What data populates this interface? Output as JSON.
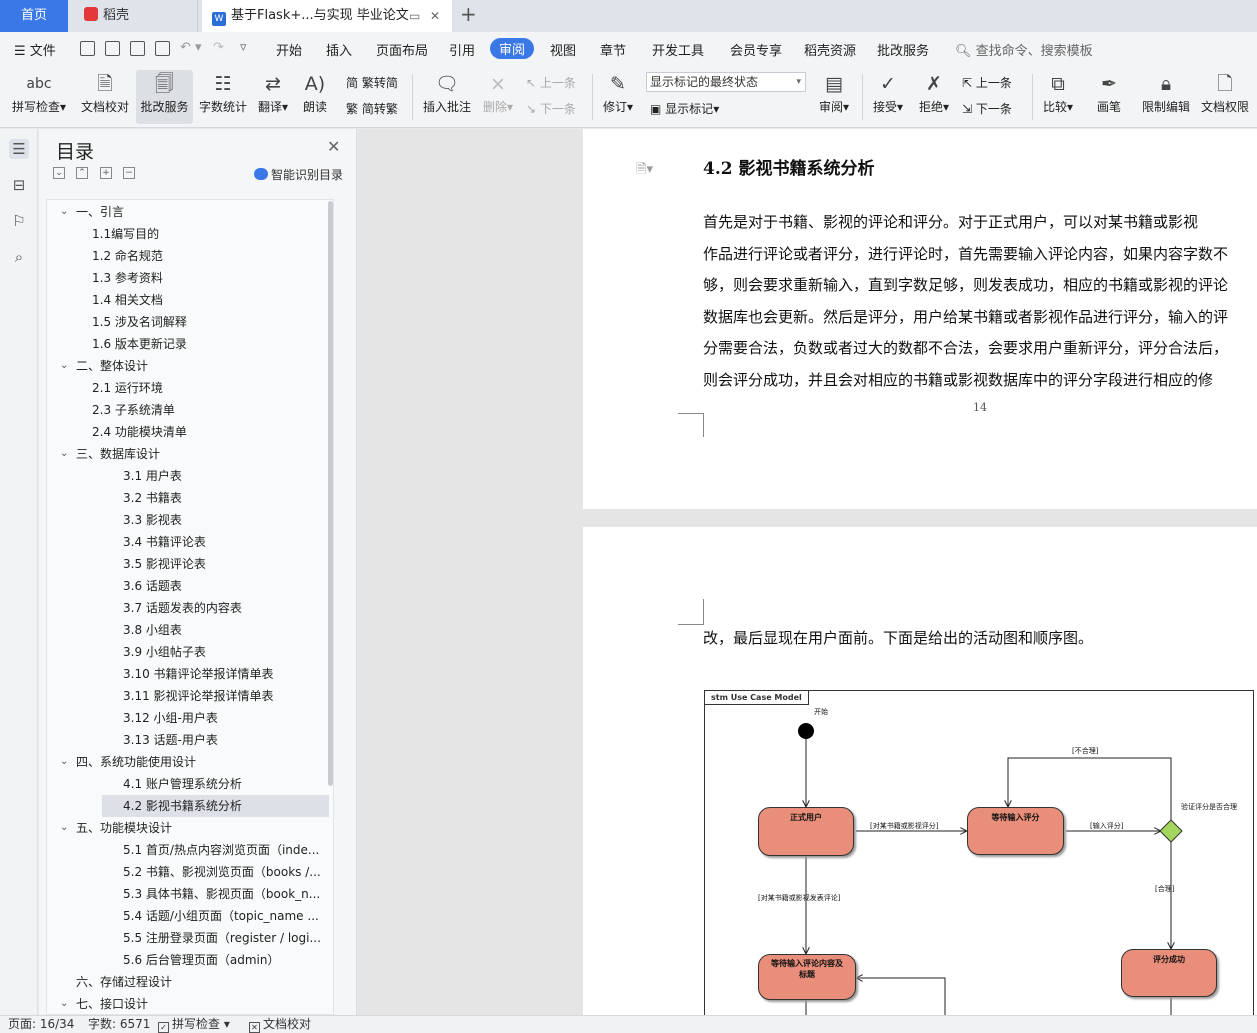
{
  "tabs": {
    "home": "首页",
    "wps": "稻壳",
    "doc": "基于Flask+...与实现 毕业论文"
  },
  "menu": [
    "文件",
    "开始",
    "插入",
    "页面布局",
    "引用",
    "审阅",
    "视图",
    "章节",
    "开发工具",
    "会员专享",
    "稻壳资源",
    "批改服务"
  ],
  "menu_active": "审阅",
  "search_cmd": "查找命令、搜索模板",
  "ribbon": {
    "spellcheck": "拼写检查",
    "doc_proof": "文档校对",
    "review_service": "批改服务",
    "word_count": "字数统计",
    "translate": "翻译",
    "read_aloud": "朗读",
    "to_traditional": "繁转简",
    "to_simplified": "简转繁",
    "insert_comment": "插入批注",
    "delete": "删除",
    "prev": "上一条",
    "next": "下一条",
    "track_changes": "修订",
    "markup_state": "显示标记的最终状态",
    "show_markup": "显示标记",
    "review": "审阅",
    "accept": "接受",
    "reject": "拒绝",
    "prev2": "上一条",
    "next2": "下一条",
    "compare": "比较",
    "pen": "画笔",
    "restrict_edit": "限制编辑",
    "doc_permission": "文档权限"
  },
  "toc": {
    "title": "目录",
    "smart": "智能识别目录",
    "items": [
      {
        "label": "一、引言",
        "level": 1,
        "expanded": true
      },
      {
        "label": "1.1编写目的",
        "level": 2
      },
      {
        "label": "1.2  命名规范",
        "level": 2
      },
      {
        "label": "1.3  参考资料",
        "level": 2
      },
      {
        "label": "1.4  相关文档",
        "level": 2
      },
      {
        "label": "1.5  涉及名词解释",
        "level": 2
      },
      {
        "label": "1.6  版本更新记录",
        "level": 2
      },
      {
        "label": "二、整体设计",
        "level": 1,
        "expanded": true
      },
      {
        "label": "2.1  运行环境",
        "level": 2
      },
      {
        "label": "2.3  子系统清单",
        "level": 2
      },
      {
        "label": "2.4  功能模块清单",
        "level": 2
      },
      {
        "label": "三、数据库设计",
        "level": 1,
        "expanded": true
      },
      {
        "label": "3.1  用户表",
        "level": 3
      },
      {
        "label": "3.2  书籍表",
        "level": 3
      },
      {
        "label": "3.3  影视表",
        "level": 3
      },
      {
        "label": "3.4  书籍评论表",
        "level": 3
      },
      {
        "label": "3.5  影视评论表",
        "level": 3
      },
      {
        "label": "3.6  话题表",
        "level": 3
      },
      {
        "label": "3.7  话题发表的内容表",
        "level": 3
      },
      {
        "label": "3.8  小组表",
        "level": 3
      },
      {
        "label": "3.9  小组帖子表",
        "level": 3
      },
      {
        "label": "3.10  书籍评论举报详情单表",
        "level": 3
      },
      {
        "label": "3.11  影视评论举报详情单表",
        "level": 3
      },
      {
        "label": "3.12  小组-用户表",
        "level": 3
      },
      {
        "label": "3.13  话题-用户表",
        "level": 3
      },
      {
        "label": "四、系统功能使用设计",
        "level": 1,
        "expanded": true
      },
      {
        "label": "4.1  账户管理系统分析",
        "level": 3
      },
      {
        "label": "4.2  影视书籍系统分析",
        "level": 3,
        "selected": true
      },
      {
        "label": "五、功能模块设计",
        "level": 1,
        "expanded": true
      },
      {
        "label": "5.1  首页/热点内容浏览页面（inde...",
        "level": 3
      },
      {
        "label": "5.2  书籍、影视浏览页面（books /...",
        "level": 3
      },
      {
        "label": "5.3  具体书籍、影视页面（book_n...",
        "level": 3
      },
      {
        "label": "5.4  话题/小组页面（topic_name ...",
        "level": 3
      },
      {
        "label": "5.5  注册登录页面（register / logi...",
        "level": 3
      },
      {
        "label": "5.6  后台管理页面（admin）",
        "level": 3
      },
      {
        "label": "六、存储过程设计",
        "level": 1,
        "expanded": false
      },
      {
        "label": "七、接口设计",
        "level": 1,
        "expanded": true
      }
    ]
  },
  "doc": {
    "heading": "4.2  影视书籍系统分析",
    "paragraph": "首先是对于书籍、影视的评论和评分。对于正式用户，可以对某书籍或影视\n作品进行评论或者评分，进行评论时，首先需要输入评论内容，如果内容字数不\n够，则会要求重新输入，直到字数足够，则发表成功，相应的书籍或影视的评论\n数据库也会更新。然后是评分，用户给某书籍或者影视作品进行评分，输入的评\n分需要合法，负数或者过大的数都不合法，会要求用户重新评分，评分合法后，\n则会评分成功，并且会对相应的书籍或影视数据库中的评分字段进行相应的修",
    "paragraph_indent": "      ",
    "page_number": "14",
    "paragraph2": "改，最后显现在用户面前。下面是给出的活动图和顺序图。"
  },
  "diagram": {
    "title": "stm Use Case Model",
    "start": "开始",
    "node_user": "正式用户",
    "node_wait_score": "等待输入评分",
    "node_wait_comment": "等待输入评论内容及\n标题",
    "node_score_ok": "评分成功",
    "decision": "验证评分是否合理",
    "lbl_score": "[对某书籍或影视评分]",
    "lbl_input_score": "[输入评分]",
    "lbl_invalid": "[不合理]",
    "lbl_valid": "[合理]",
    "lbl_comment": "[对某书籍或影视发表评论]",
    "node_color": "#e98e7a",
    "decision_color": "#a4d65e"
  },
  "status": {
    "page": "页面: 16/34",
    "words": "字数: 6571",
    "spellcheck": "拼写检查",
    "doc_proof": "文档校对"
  },
  "colors": {
    "accent": "#3b78e7"
  }
}
